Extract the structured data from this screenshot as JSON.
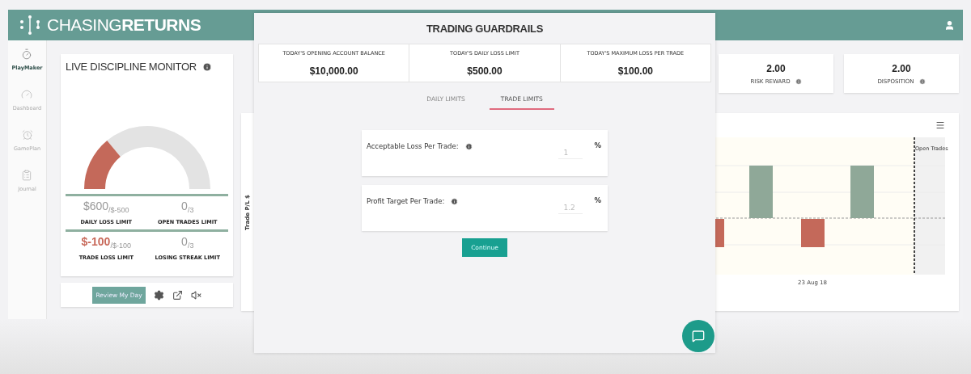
{
  "header": {
    "brand_light": "CHASING",
    "brand_bold": "RETURNS"
  },
  "sidebar": {
    "items": [
      {
        "label": "PlayMaker",
        "kind": "stopwatch",
        "selected": true
      },
      {
        "label": "Dashboard",
        "kind": "gauge",
        "selected": false
      },
      {
        "label": "GamePlan",
        "kind": "clock",
        "selected": false
      },
      {
        "label": "Journal",
        "kind": "clipboard",
        "selected": false
      }
    ]
  },
  "monitor": {
    "title": "LIVE DISCIPLINE MONITOR",
    "metrics": [
      {
        "value": "$600",
        "limit": "/$-500",
        "label": "DAILY LOSS LIMIT",
        "breached": false
      },
      {
        "value": "0",
        "limit": "/3",
        "label": "OPEN TRADES LIMIT",
        "breached": false
      },
      {
        "value": "$-100",
        "limit": "/$-100",
        "label": "TRADE LOSS LIMIT",
        "breached": true
      },
      {
        "value": "0",
        "limit": "/3",
        "label": "LOSING STREAK LIMIT",
        "breached": false
      }
    ],
    "review_button": "Review My Day"
  },
  "stats": [
    {
      "value": "2.00",
      "label": "RISK REWARD"
    },
    {
      "value": "2.00",
      "label": "DISPOSITION"
    }
  ],
  "chart": {
    "y_label": "Trade P/L $",
    "marker_label": "Open Trades",
    "x_label": "23 Aug 18"
  },
  "modal": {
    "title": "TRADING GUARDRAILS",
    "summary": [
      {
        "label": "TODAY'S OPENING ACCOUNT BALANCE",
        "value": "$10,000.00"
      },
      {
        "label": "TODAY'S DAILY LOSS LIMIT",
        "value": "$500.00"
      },
      {
        "label": "TODAY'S MAXIMUM LOSS PER TRADE",
        "value": "$100.00"
      }
    ],
    "tabs": [
      {
        "label": "DAILY LIMITS",
        "selected": false
      },
      {
        "label": "TRADE LIMITS",
        "selected": true
      }
    ],
    "fields": [
      {
        "label": "Acceptable Loss Per Trade:",
        "placeholder": "1",
        "unit": "%"
      },
      {
        "label": "Profit Target Per Trade:",
        "placeholder": "1.2",
        "unit": "%"
      }
    ],
    "continue_button": "Continue"
  }
}
